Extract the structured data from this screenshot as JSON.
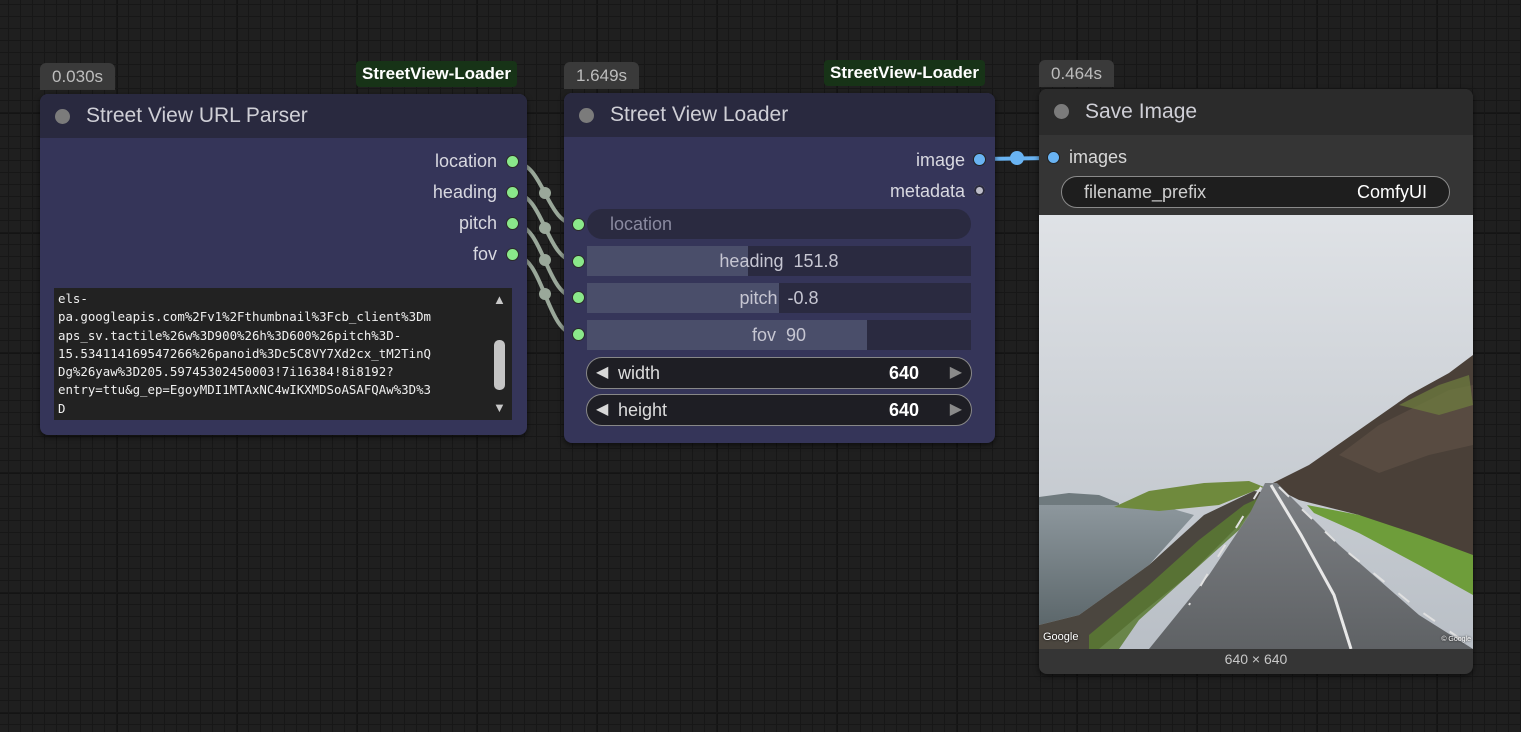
{
  "nodes": {
    "url_parser": {
      "timing": "0.030s",
      "badge": "StreetView-Loader",
      "title": "Street View URL Parser",
      "outputs": [
        "location",
        "heading",
        "pitch",
        "fov"
      ],
      "url_text": "els-\npa.googleapis.com%2Fv1%2Fthumbnail%3Fcb_client%3Dm\naps_sv.tactile%26w%3D900%26h%3D600%26pitch%3D-\n15.534114169547266%26panoid%3Dc5C8VY7Xd2cx_tM2TinQ\nDg%26yaw%3D205.59745302450003!7i16384!8i8192?\nentry=ttu&g_ep=EgoyMDI1MTAxNC4wIKXMDSoASAFQAw%3D%3\nD"
    },
    "loader": {
      "timing": "1.649s",
      "badge": "StreetView-Loader",
      "title": "Street View Loader",
      "outputs": [
        "image",
        "metadata"
      ],
      "location_placeholder": "location",
      "heading": {
        "label": "heading",
        "value": "151.8",
        "fill": 0.42
      },
      "pitch": {
        "label": "pitch",
        "value": "-0.8",
        "fill": 0.5
      },
      "fov": {
        "label": "fov",
        "value": "90",
        "fill": 0.75
      },
      "width": {
        "label": "width",
        "value": "640"
      },
      "height": {
        "label": "height",
        "value": "640"
      }
    },
    "save": {
      "timing": "0.464s",
      "title": "Save Image",
      "input": "images",
      "filename_prefix": {
        "label": "filename_prefix",
        "value": "ComfyUI"
      },
      "preview_size": "640 × 640",
      "watermark_left": "Google",
      "watermark_right": "© Google"
    }
  },
  "icons": {
    "arrow_left": "◀",
    "arrow_right": "▶",
    "scroll_up": "▲",
    "scroll_down": "▼"
  },
  "colors": {
    "canvas": "#1f1f1f",
    "node_body": "#353559",
    "node_title": "#29293f",
    "slot_green": "#8ae88a",
    "slot_image": "#69b3f2",
    "badge_bg": "#173317"
  }
}
